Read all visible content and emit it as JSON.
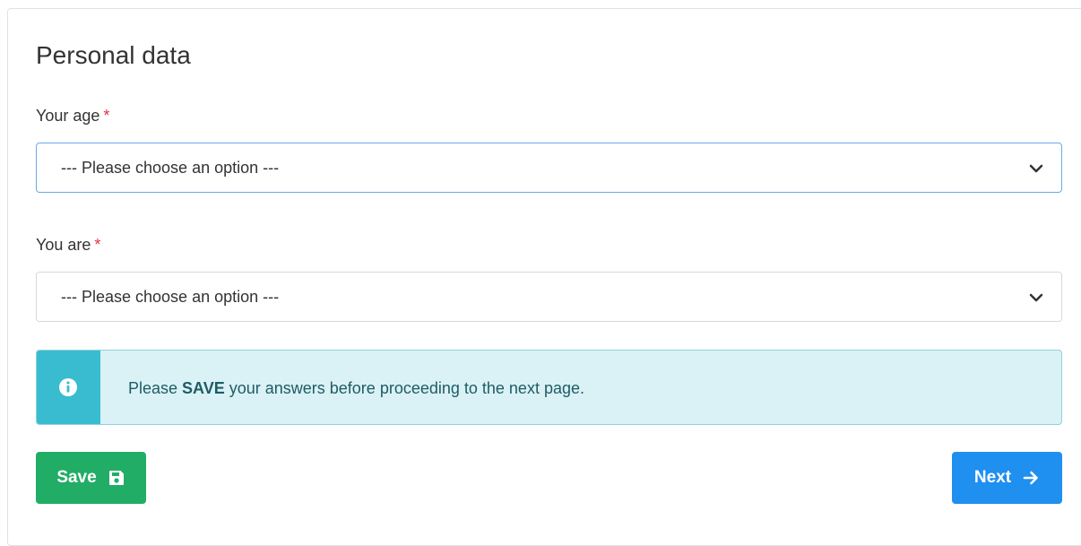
{
  "section": {
    "title": "Personal data"
  },
  "fields": {
    "age": {
      "label": "Your age",
      "required_marker": "*",
      "selected": "--- Please choose an option ---"
    },
    "you_are": {
      "label": "You are",
      "required_marker": "*",
      "selected": "--- Please choose an option ---"
    }
  },
  "alert": {
    "icon": "info-circle-icon",
    "text_before": "Please ",
    "text_bold": "SAVE",
    "text_after": " your answers before proceeding to the next page."
  },
  "buttons": {
    "save_label": "Save",
    "save_icon": "floppy-disk-icon",
    "next_label": "Next",
    "next_icon": "arrow-right-icon"
  },
  "colors": {
    "save": "#22ad66",
    "next": "#1f8ff0",
    "alert_bg": "#daf2f5",
    "alert_accent": "#39bccf",
    "required": "#dc3545"
  }
}
